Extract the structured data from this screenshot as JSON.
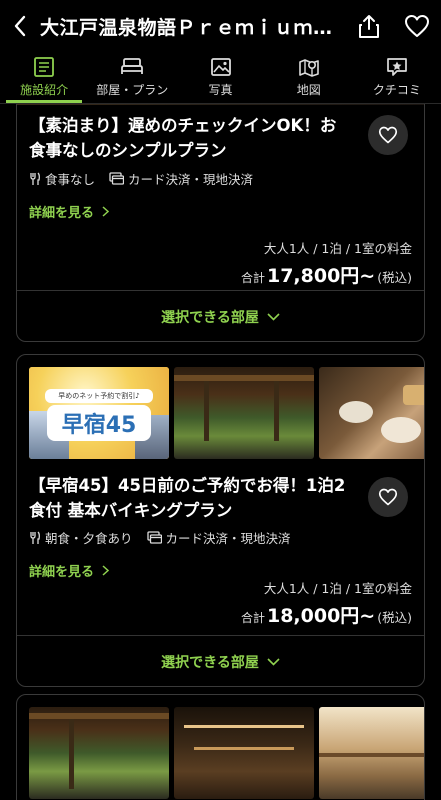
{
  "header": {
    "title": "大江戸温泉物語Ｐｒｅｍｉｕｍ…"
  },
  "tabs": [
    {
      "label": "施設紹介",
      "icon": "document-icon"
    },
    {
      "label": "部屋・プラン",
      "icon": "bed-icon"
    },
    {
      "label": "写真",
      "icon": "image-icon"
    },
    {
      "label": "地図",
      "icon": "map-icon"
    },
    {
      "label": "クチコミ",
      "icon": "review-icon"
    }
  ],
  "colors": {
    "accent": "#8fd14f",
    "background": "#000000",
    "border": "#3a3a3a"
  },
  "plans": [
    {
      "title": "【素泊まり】遅めのチェックインOK！お食事なしのシンプルプラン",
      "tags": [
        "食事なし",
        "カード決済・現地決済"
      ],
      "detail_label": "詳細を見る",
      "price_condition": "大人1人 / 1泊 / 1室の料金",
      "price_prefix": "合計",
      "price": "17,800円~",
      "price_tax": "(税込)",
      "select_label": "選択できる部屋"
    },
    {
      "banner_small": "早めのネット予約で割引♪",
      "banner_big": "早宿45",
      "title": "【早宿45】45日前のご予約でお得！1泊2食付 基本バイキングプラン",
      "tags": [
        "朝食・夕食あり",
        "カード決済・現地決済"
      ],
      "detail_label": "詳細を見る",
      "price_condition": "大人1人 / 1泊 / 1室の料金",
      "price_prefix": "合計",
      "price": "18,000円~",
      "price_tax": "(税込)",
      "select_label": "選択できる部屋"
    }
  ]
}
